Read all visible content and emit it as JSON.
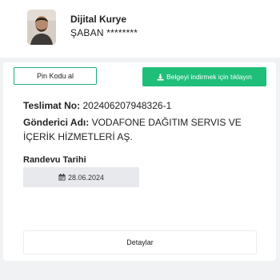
{
  "courier": {
    "title": "Dijital Kurye",
    "name": "ŞABAN ********"
  },
  "actions": {
    "pin_label": "Pin Kodu al",
    "download_label": "Belgeyi indirmek için tıklayın",
    "download_icon": "download-icon",
    "details_label": "Detaylar"
  },
  "delivery": {
    "tracking_label": "Teslimat No:",
    "tracking_value": "202406207948326-1",
    "sender_label": "Gönderici Adı:",
    "sender_value": "VODAFONE DAĞITIM SERVIS VE İÇERİK HİZMETLERİ AŞ.",
    "appointment_label": "Randevu Tarihi",
    "appointment_date": "28.06.2024",
    "calendar_icon": "calendar-icon"
  },
  "colors": {
    "accent_green": "#1fbf7a",
    "outline_green": "#1aaf7a",
    "background": "#f1f2f4"
  }
}
